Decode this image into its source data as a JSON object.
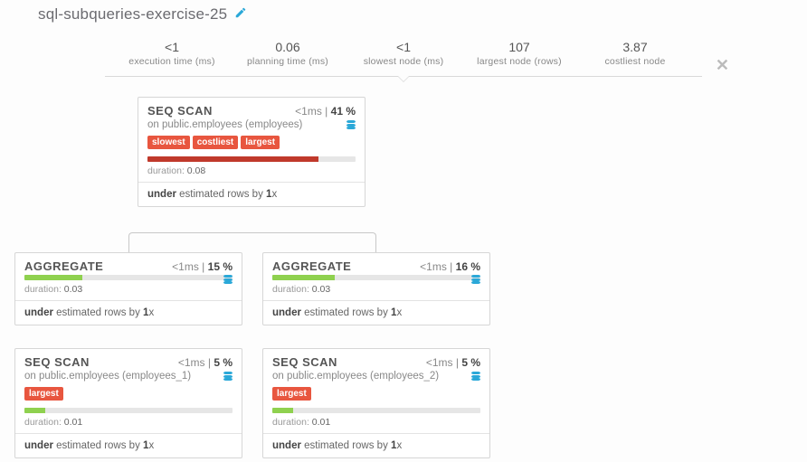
{
  "title": "sql-subqueries-exercise-25",
  "stats": [
    {
      "value": "<1",
      "label": "execution time (ms)"
    },
    {
      "value": "0.06",
      "label": "planning time (ms)"
    },
    {
      "value": "<1",
      "label": "slowest node (ms)"
    },
    {
      "value": "107",
      "label": "largest node (rows)"
    },
    {
      "value": "3.87",
      "label": "costliest node"
    }
  ],
  "nodes": {
    "root": {
      "title": "SEQ SCAN",
      "time": "<1ms",
      "pct": "41 %",
      "subtitle": "on public.employees (employees)",
      "tags": [
        "slowest",
        "costliest",
        "largest"
      ],
      "bar_color": "red",
      "bar_width": "82%",
      "duration": "0.08",
      "est_prefix": "under",
      "est_by": "1"
    },
    "agg_left": {
      "title": "AGGREGATE",
      "time": "<1ms",
      "pct": "15 %",
      "subtitle": "",
      "tags": [],
      "bar_color": "green",
      "bar_width": "28%",
      "duration": "0.03",
      "est_prefix": "under",
      "est_by": "1"
    },
    "agg_right": {
      "title": "AGGREGATE",
      "time": "<1ms",
      "pct": "16 %",
      "subtitle": "",
      "tags": [],
      "bar_color": "green",
      "bar_width": "30%",
      "duration": "0.03",
      "est_prefix": "under",
      "est_by": "1"
    },
    "scan_left": {
      "title": "SEQ SCAN",
      "time": "<1ms",
      "pct": "5 %",
      "subtitle": "on public.employees (employees_1)",
      "tags": [
        "largest"
      ],
      "bar_color": "green",
      "bar_width": "10%",
      "duration": "0.01",
      "est_prefix": "under",
      "est_by": "1"
    },
    "scan_right": {
      "title": "SEQ SCAN",
      "time": "<1ms",
      "pct": "5 %",
      "subtitle": "on public.employees (employees_2)",
      "tags": [
        "largest"
      ],
      "bar_color": "green",
      "bar_width": "10%",
      "duration": "0.01",
      "est_prefix": "under",
      "est_by": "1"
    }
  },
  "labels": {
    "duration_prefix": "duration: ",
    "est_mid": " estimated rows by ",
    "est_suffix": "x"
  }
}
